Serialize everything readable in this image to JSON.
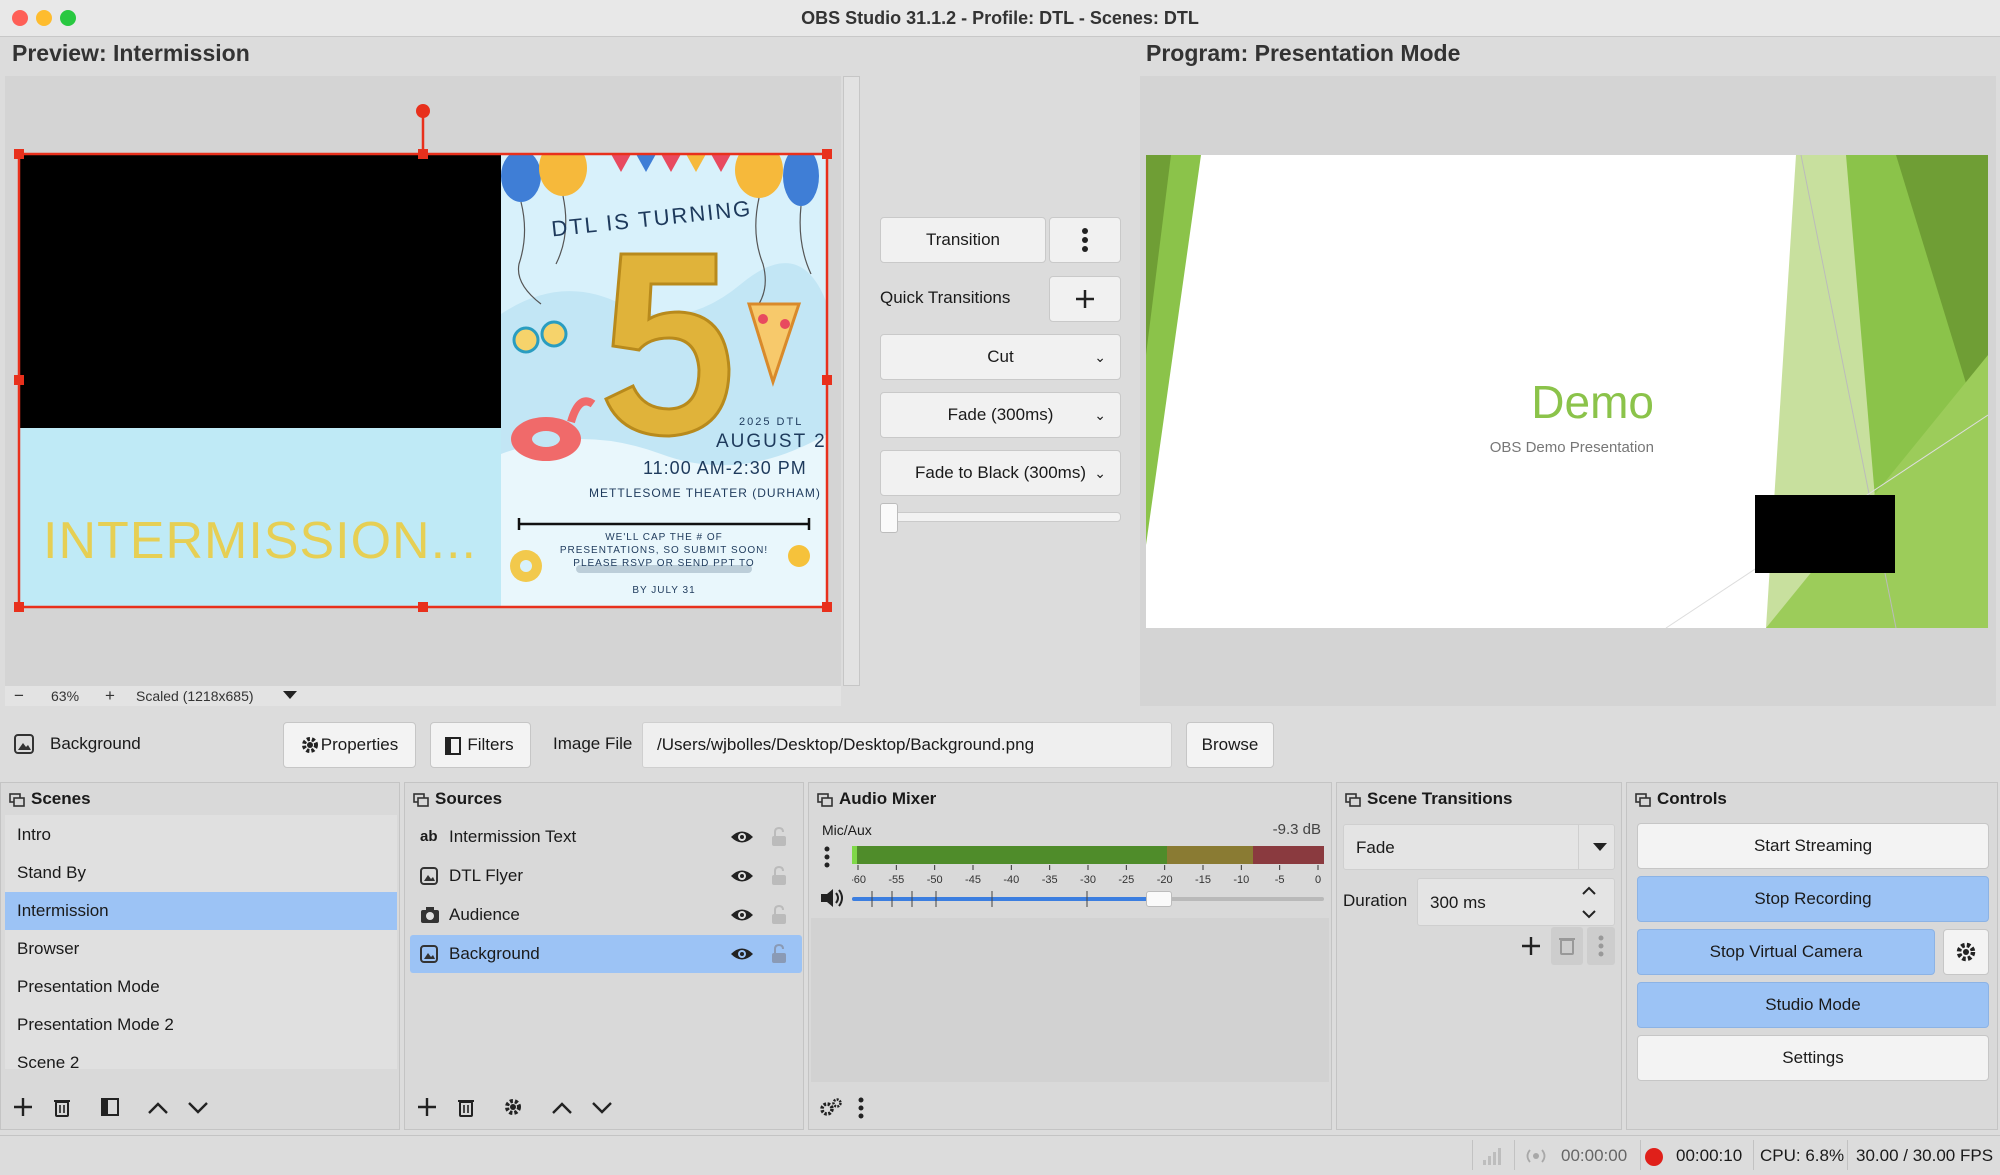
{
  "window": {
    "title": "OBS Studio 31.1.2 - Profile: DTL - Scenes: DTL"
  },
  "preview": {
    "heading": "Preview: Intermission",
    "zoom_minus": "−",
    "zoom_level": "63%",
    "zoom_plus": "+",
    "scale_mode": "Scaled (1218x685)",
    "intermission_text": "INTERMISSION...",
    "flyer": {
      "headline": "DTL IS TURNING",
      "number": "5",
      "year_line": "2025 DTL",
      "date": "AUGUST 2",
      "time": "11:00 AM-2:30 PM",
      "venue": "METTLESOME THEATER (DURHAM)",
      "note_line1": "WE'LL CAP THE # OF",
      "note_line2": "PRESENTATIONS, SO SUBMIT SOON!",
      "note_line3": "PLEASE RSVP OR SEND PPT TO",
      "deadline": "BY JULY 31"
    }
  },
  "transitions_panel": {
    "transition_label": "Transition",
    "quick_transitions_label": "Quick Transitions",
    "quick_items": [
      "Cut",
      "Fade (300ms)",
      "Fade to Black (300ms)"
    ],
    "tbar_position": 0.0
  },
  "program": {
    "heading": "Program: Presentation Mode",
    "slide_title": "Demo",
    "slide_subtitle": "OBS Demo Presentation"
  },
  "source_toolbar": {
    "source_name": "Background",
    "properties_label": "Properties",
    "filters_label": "Filters",
    "image_file_label": "Image File",
    "image_path": "/Users/wjbolles/Desktop/Desktop/Background.png",
    "browse_label": "Browse"
  },
  "scenes": {
    "title": "Scenes",
    "items": [
      "Intro",
      "Stand By",
      "Intermission",
      "Browser",
      "Presentation Mode",
      "Presentation Mode 2",
      "Scene 2"
    ],
    "selected_index": 2
  },
  "sources": {
    "title": "Sources",
    "items": [
      {
        "name": "Intermission Text",
        "type": "text"
      },
      {
        "name": "DTL Flyer",
        "type": "image"
      },
      {
        "name": "Audience",
        "type": "camera"
      },
      {
        "name": "Background",
        "type": "image"
      }
    ],
    "selected_index": 3
  },
  "audio_mixer": {
    "title": "Audio Mixer",
    "channel_name": "Mic/Aux",
    "level": "-9.3 dB",
    "meter_ticks": [
      "-60",
      "-55",
      "-50",
      "-45",
      "-40",
      "-35",
      "-30",
      "-25",
      "-20",
      "-15",
      "-10",
      "-5",
      "0"
    ],
    "volume_fraction": 0.65
  },
  "scene_transitions": {
    "title": "Scene Transitions",
    "selected": "Fade",
    "duration_label": "Duration",
    "duration_value": "300 ms"
  },
  "controls": {
    "title": "Controls",
    "start_streaming": "Start Streaming",
    "stop_recording": "Stop Recording",
    "stop_virtual_camera": "Stop Virtual Camera",
    "studio_mode": "Studio Mode",
    "settings": "Settings"
  },
  "status_bar": {
    "stream_time": "00:00:00",
    "record_time": "00:00:10",
    "cpu": "CPU: 6.8%",
    "fps": "30.00 / 30.00 FPS"
  },
  "colors": {
    "selection": "#9cc3f5",
    "handle_red": "#e8301c",
    "slide_green": "#8bc34a",
    "record_red": "#e0201a"
  }
}
